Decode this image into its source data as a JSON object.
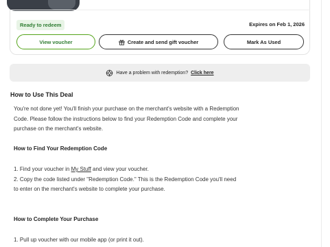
{
  "voucher": {
    "status_badge": "Ready to redeem",
    "expires": "Expires on Feb 1, 2026",
    "view_label": "View voucher",
    "gift_label": "Create and send gift voucher",
    "mark_label": "Mark As Used"
  },
  "problem_bar": {
    "text": "Have a problem with redemption?",
    "link": "Click here"
  },
  "deal_info": {
    "title": "How to Use This Deal",
    "intro": "You're not done yet! You'll finish your purchase on the merchant's website with a Redemption Code. Please follow the instructions below to find your Redemption Code and complete your purchase on the merchant's website.",
    "find_title": "How to Find Your Redemption Code",
    "step1_pre": "1. Find your voucher in ",
    "step1_link": "My Stuff",
    "step1_post": " and view your voucher.",
    "step2": "2. Copy the code listed under \"Redemption Code.\" This is the Redemption Code you'll need to enter on the merchant's website to complete your purchase.",
    "complete_title": "How to Complete Your Purchase",
    "complete_step1": "1. Pull up voucher with our mobile app (or print it out)."
  }
}
